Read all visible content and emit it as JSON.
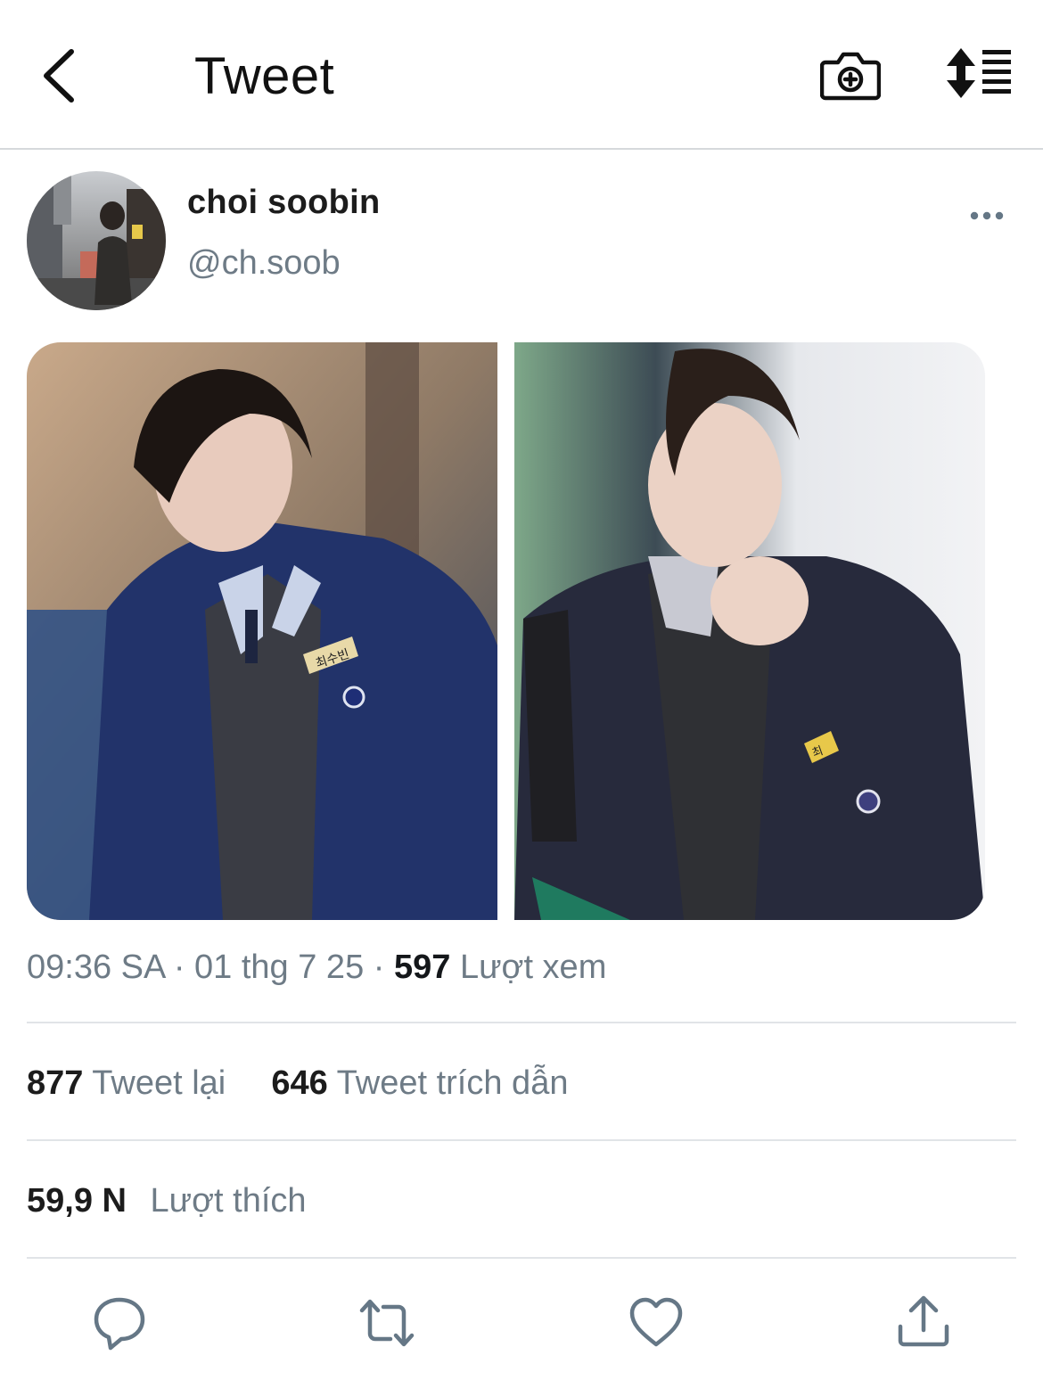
{
  "header": {
    "title": "Tweet",
    "back_icon": "chevron-left-icon",
    "camera_icon": "camera-plus-icon",
    "sort_icon": "sort-list-icon"
  },
  "tweet": {
    "author": {
      "display_name": "choi soobin",
      "handle": "@ch.soob"
    },
    "images": [
      {
        "name_tag": "최수빈"
      },
      {
        "name_tag": "최"
      }
    ],
    "meta": {
      "time": "09:36 SA",
      "separator": "·",
      "date": "01 thg 7 25",
      "views_count": "597",
      "views_label": "Lượt xem"
    },
    "stats": {
      "retweets_count": "877",
      "retweets_label": "Tweet lại",
      "quotes_count": "646",
      "quotes_label": "Tweet trích dẫn",
      "likes_count": "59,9 N",
      "likes_label": "Lượt thích"
    }
  },
  "actions": [
    "reply-icon",
    "retweet-icon",
    "like-icon",
    "share-icon"
  ],
  "colors": {
    "icon": "#657786",
    "muted_text": "#6e7b86",
    "divider": "#e1e4e7"
  }
}
